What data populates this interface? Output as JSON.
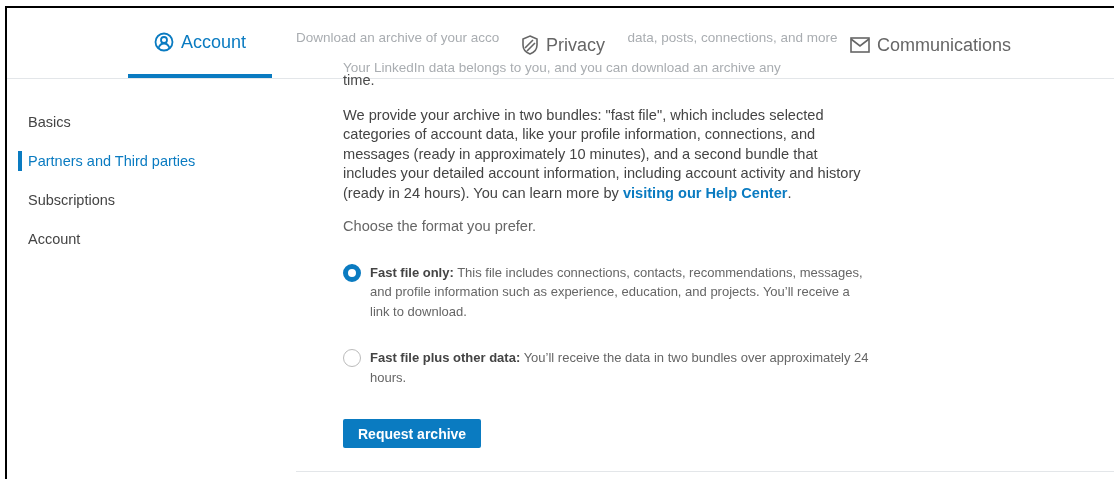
{
  "tabs": [
    {
      "label": "Account",
      "kind": "person",
      "selected": true
    },
    {
      "label": "Privacy",
      "kind": "shield",
      "selected": false
    },
    {
      "label": "Communications",
      "kind": "envelope",
      "selected": false
    }
  ],
  "background_text": {
    "heading_start": "Download an archive of your acco",
    "heading_end": "data, posts, connections, and more",
    "intro": "Your LinkedIn data belongs to you, and you can download an archive any"
  },
  "sidebar": {
    "items": [
      {
        "label": "Basics",
        "selected": false
      },
      {
        "label": "Partners and Third parties",
        "selected": true
      },
      {
        "label": "Subscriptions",
        "selected": false
      },
      {
        "label": "Account",
        "selected": false
      }
    ]
  },
  "content": {
    "intro_end": "time.",
    "bundles_text": "We provide your archive in two bundles: \"fast file\", which includes selected categories of account data, like your profile information, connections, and messages (ready in approximately 10 minutes), and a second bundle that includes your detailed account information, including account activity and history (ready in 24 hours). You can learn more by ",
    "help_link": "visiting our Help Center",
    "bundles_end": ".",
    "prompt": "Choose the format you prefer.",
    "options": [
      {
        "text": "**Fast file only:** This file includes connections, contacts, recommendations, messages, and profile information such as experience, education, and projects. You’ll receive a link to download.",
        "selected": true
      },
      {
        "text": "**Fast file plus other data:** You’ll receive the data in two bundles over approximately 24 hours.",
        "selected": false
      }
    ],
    "button": "Request archive"
  }
}
